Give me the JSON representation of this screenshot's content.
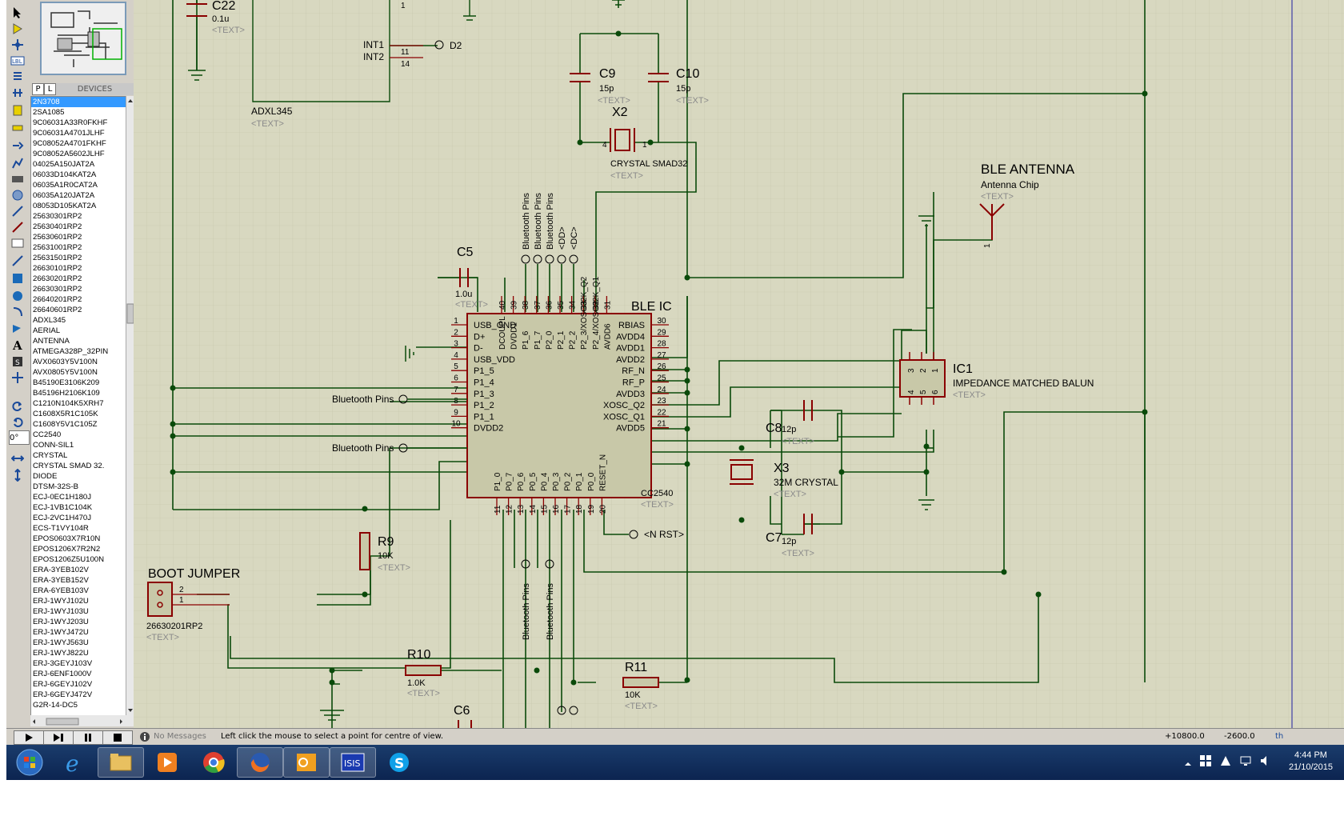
{
  "toolbar": {
    "tools": [
      "select-icon",
      "component-icon",
      "junction-icon",
      "wire-label-icon",
      "text-script-icon",
      "bus-icon",
      "subcircuit-icon",
      "terminal-icon",
      "pin-icon",
      "graph-icon",
      "tape-icon",
      "generator-icon",
      "probe-voltage-icon",
      "probe-current-icon",
      "virtual-instrument-icon",
      "line-icon",
      "box-icon",
      "circle-icon",
      "arc-icon",
      "path-icon",
      "text-icon",
      "symbol-icon",
      "marker-icon",
      "rotate-cw-icon",
      "rotate-ccw-icon",
      "angle-input",
      "flip-h-icon",
      "flip-v-icon"
    ],
    "angle": "0°"
  },
  "device_panel": {
    "p_button": "P",
    "l_button": "L",
    "title": "DEVICES",
    "selected": "2N3708",
    "items": [
      "2N3708",
      "2SA1085",
      "9C06031A33R0FKHF",
      "9C06031A4701JLHF",
      "9C08052A4701FKHF",
      "9C08052A5602JLHF",
      "04025A150JAT2A",
      "06033D104KAT2A",
      "06035A1R0CAT2A",
      "06035A120JAT2A",
      "08053D105KAT2A",
      "25630301RP2",
      "25630401RP2",
      "25630601RP2",
      "25631001RP2",
      "25631501RP2",
      "26630101RP2",
      "26630201RP2",
      "26630301RP2",
      "26640201RP2",
      "26640601RP2",
      "ADXL345",
      "AERIAL",
      "ANTENNA",
      "ATMEGA328P_32PIN",
      "AVX0603Y5V100N",
      "AVX0805Y5V100N",
      "B45190E3106K209",
      "B45196H2106K109",
      "C1210N104K5XRH7",
      "C1608X5R1C105K",
      "C1608Y5V1C105Z",
      "CC2540",
      "CONN-SIL1",
      "CRYSTAL",
      "CRYSTAL SMAD 32.",
      "DIODE",
      "DTSM-32S-B",
      "ECJ-0EC1H180J",
      "ECJ-1VB1C104K",
      "ECJ-2VC1H470J",
      "ECS-T1VY104R",
      "EPOS0603X7R10N",
      "EPOS1206X7R2N2",
      "EPOS1206Z5U100N",
      "ERA-3YEB102V",
      "ERA-3YEB152V",
      "ERA-6YEB103V",
      "ERJ-1WYJ102U",
      "ERJ-1WYJ103U",
      "ERJ-1WYJ203U",
      "ERJ-1WYJ472U",
      "ERJ-1WYJ563U",
      "ERJ-1WYJ822U",
      "ERJ-3GEYJ103V",
      "ERJ-6ENF1000V",
      "ERJ-6GEYJ102V",
      "ERJ-6GEYJ472V",
      "G2R-14-DC5"
    ]
  },
  "schematic": {
    "c22": {
      "ref": "C22",
      "value": "0.1u",
      "text": "<TEXT>"
    },
    "adxl": {
      "ref": "ADXL345",
      "text": "<TEXT>",
      "pin_int1": "INT1",
      "pin_int2": "INT2",
      "num_11": "11",
      "num_14": "14",
      "num_1": "1",
      "d2": "D2"
    },
    "c9": {
      "ref": "C9",
      "value": "15p",
      "text": "<TEXT>"
    },
    "c10": {
      "ref": "C10",
      "value": "15p",
      "text": "<TEXT>"
    },
    "x2": {
      "ref": "X2",
      "value": "CRYSTAL SMAD32",
      "text": "<TEXT>",
      "pin4": "4",
      "pin1": "1"
    },
    "c5": {
      "ref": "C5",
      "value": "1.0u",
      "text": "<TEXT>"
    },
    "top_labels": [
      "Bluetooth Pins",
      "Bluetooth Pins",
      "Bluetooth Pins",
      "<DD>",
      "<DC>"
    ],
    "bleic": {
      "title": "BLE IC",
      "part": "CC2540",
      "text": "<TEXT>",
      "left_pins": [
        {
          "num": "1",
          "name": "USB_GND"
        },
        {
          "num": "2",
          "name": "D+"
        },
        {
          "num": "3",
          "name": "D-"
        },
        {
          "num": "4",
          "name": "USB_VDD"
        },
        {
          "num": "5",
          "name": "P1_5"
        },
        {
          "num": "6",
          "name": "P1_4"
        },
        {
          "num": "7",
          "name": "P1_3"
        },
        {
          "num": "8",
          "name": "P1_2"
        },
        {
          "num": "9",
          "name": "P1_1"
        },
        {
          "num": "10",
          "name": "DVDD2"
        }
      ],
      "right_pins": [
        {
          "num": "30",
          "name": "RBIAS"
        },
        {
          "num": "29",
          "name": "AVDD4"
        },
        {
          "num": "28",
          "name": "AVDD1"
        },
        {
          "num": "27",
          "name": "AVDD2"
        },
        {
          "num": "26",
          "name": "RF_N"
        },
        {
          "num": "25",
          "name": "RF_P"
        },
        {
          "num": "24",
          "name": "AVDD3"
        },
        {
          "num": "23",
          "name": "XOSC_Q2"
        },
        {
          "num": "22",
          "name": "XOSC_Q1"
        },
        {
          "num": "21",
          "name": "AVDD5"
        }
      ],
      "top_pins": [
        {
          "num": "40",
          "name": "DCOUPL"
        },
        {
          "num": "39",
          "name": "DVDD1"
        },
        {
          "num": "38",
          "name": "P1_6"
        },
        {
          "num": "37",
          "name": "P1_7"
        },
        {
          "num": "36",
          "name": "P2_0"
        },
        {
          "num": "35",
          "name": "P2_1"
        },
        {
          "num": "34",
          "name": "P2_2"
        },
        {
          "num": "33",
          "name": "P2_3/XOSC32K_Q2"
        },
        {
          "num": "32",
          "name": "P2_4/XOSC32K_Q1"
        },
        {
          "num": "31",
          "name": "AVDD6"
        }
      ],
      "bottom_pins": [
        {
          "num": "11",
          "name": "P1_0"
        },
        {
          "num": "12",
          "name": "P0_7"
        },
        {
          "num": "13",
          "name": "P0_6"
        },
        {
          "num": "14",
          "name": "P0_5"
        },
        {
          "num": "15",
          "name": "P0_4"
        },
        {
          "num": "16",
          "name": "P0_3"
        },
        {
          "num": "17",
          "name": "P0_2"
        },
        {
          "num": "18",
          "name": "P0_1"
        },
        {
          "num": "19",
          "name": "P0_0"
        },
        {
          "num": "20",
          "name": "RESET_N"
        }
      ],
      "gnd_mark": "GND"
    },
    "bt_left_1": "Bluetooth Pins",
    "bt_left_2": "Bluetooth Pins",
    "nrst": "<N RST>",
    "bt_bottom_1": "Bluetooth Pins",
    "bt_bottom_2": "Bluetooth Pins",
    "antenna": {
      "title": "BLE ANTENNA",
      "value": "Antenna Chip",
      "text": "<TEXT>",
      "pin": "1"
    },
    "ic1": {
      "ref": "IC1",
      "value": "IMPEDANCE MATCHED BALUN",
      "text": "<TEXT>",
      "pins_top": [
        "3",
        "2",
        "1"
      ],
      "pins_bottom": [
        "4",
        "5",
        "6"
      ]
    },
    "c8": {
      "ref": "C8",
      "value": "12p",
      "text": "<TEXT>"
    },
    "x3": {
      "ref": "X3",
      "value": "32M CRYSTAL",
      "text": "<TEXT>"
    },
    "c7": {
      "ref": "C7",
      "value": "12p",
      "text": "<TEXT>"
    },
    "r9": {
      "ref": "R9",
      "value": "10K",
      "text": "<TEXT>"
    },
    "boot": {
      "title": "BOOT JUMPER",
      "part": "26630201RP2",
      "text": "<TEXT>",
      "pin2": "2",
      "pin1": "1"
    },
    "r10": {
      "ref": "R10",
      "value": "1.0K",
      "text": "<TEXT>"
    },
    "r11": {
      "ref": "R11",
      "value": "10K",
      "text": "<TEXT>"
    },
    "c6": {
      "ref": "C6"
    }
  },
  "statusbar": {
    "messages": "No Messages",
    "hint": "Left click the mouse to select a point for centre of view.",
    "coord_x": "+10800.0",
    "coord_y": "-2600.0",
    "unit": "th"
  },
  "taskbar": {
    "apps": [
      "start-button",
      "internet-explorer-icon",
      "file-explorer-icon",
      "media-player-icon",
      "chrome-icon",
      "firefox-icon",
      "outlook-icon",
      "isis-icon",
      "skype-icon"
    ],
    "isis_label": "ISIS",
    "time": "4:44 PM",
    "date": "21/10/2015"
  },
  "colors": {
    "canvas": "#d8d8c0",
    "wire": "#0a4a0a",
    "component": "#8a0000",
    "body": "#c8c8a8",
    "text": "#000000",
    "hint": "#8a8a8a"
  }
}
